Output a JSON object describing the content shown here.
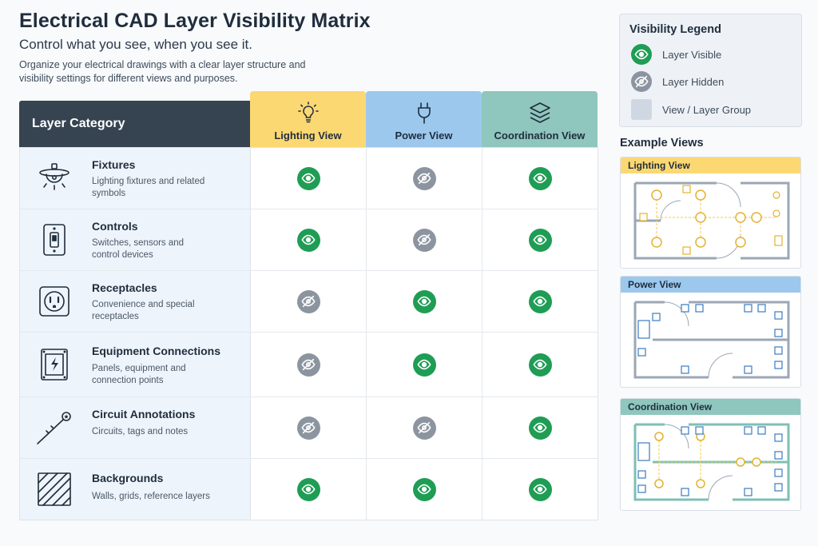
{
  "header": {
    "title": "Electrical CAD Layer Visibility Matrix",
    "subtitle": "Control what you see, when you see it.",
    "description": "Organize your electrical drawings with a clear layer structure and visibility settings for different views and purposes."
  },
  "matrix": {
    "category_header": "Layer Category",
    "views": [
      {
        "label": "Lighting View",
        "color": "#fcd873",
        "icon": "lightbulb-icon"
      },
      {
        "label": "Power View",
        "color": "#9cc8ee",
        "icon": "plug-icon"
      },
      {
        "label": "Coordination View",
        "color": "#8fc6bd",
        "icon": "layers-icon"
      }
    ],
    "rows": [
      {
        "name": "Fixtures",
        "description": "Lighting fixtures and related symbols",
        "icon": "ceiling-light-icon",
        "visibility": [
          true,
          false,
          true
        ]
      },
      {
        "name": "Controls",
        "description": "Switches, sensors and control devices",
        "icon": "switch-icon",
        "visibility": [
          true,
          false,
          true
        ]
      },
      {
        "name": "Receptacles",
        "description": "Convenience and special receptacles",
        "icon": "outlet-icon",
        "visibility": [
          false,
          true,
          true
        ]
      },
      {
        "name": "Equipment Connections",
        "description": "Panels, equipment and connection points",
        "icon": "panel-icon",
        "visibility": [
          false,
          true,
          true
        ]
      },
      {
        "name": "Circuit Annotations",
        "description": "Circuits, tags and notes",
        "icon": "circuit-tag-icon",
        "visibility": [
          false,
          false,
          true
        ]
      },
      {
        "name": "Backgrounds",
        "description": "Walls, grids, reference layers",
        "icon": "hatch-icon",
        "visibility": [
          true,
          true,
          true
        ]
      }
    ]
  },
  "legend": {
    "title": "Visibility Legend",
    "items": [
      {
        "label": "Layer Visible",
        "icon": "eye-icon",
        "color": "#1f9d55"
      },
      {
        "label": "Layer Hidden",
        "icon": "eye-off-icon",
        "color": "#8c959f"
      },
      {
        "label": "View / Layer Group",
        "icon": "group-swatch",
        "color": "#cfd8e2"
      }
    ]
  },
  "examples": {
    "title": "Example Views",
    "cards": [
      {
        "label": "Lighting View",
        "color": "#fcd873"
      },
      {
        "label": "Power View",
        "color": "#9cc8ee"
      },
      {
        "label": "Coordination View",
        "color": "#8fc6bd"
      }
    ]
  }
}
